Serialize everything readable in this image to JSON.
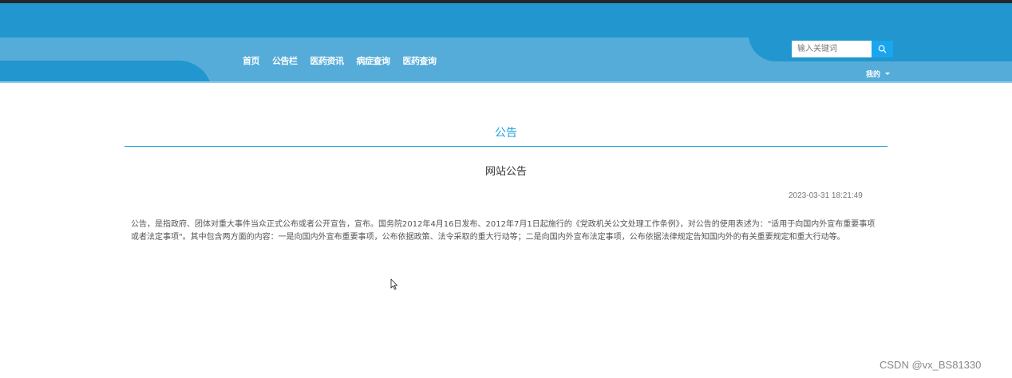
{
  "nav": {
    "items": [
      {
        "label": "首页"
      },
      {
        "label": "公告栏"
      },
      {
        "label": "医药资讯"
      },
      {
        "label": "病症查询"
      },
      {
        "label": "医药查询"
      }
    ]
  },
  "search": {
    "placeholder": "输入关键词",
    "value": ""
  },
  "user_menu": {
    "label": "我的"
  },
  "section": {
    "title": "公告"
  },
  "article": {
    "title": "网站公告",
    "date": "2023-03-31 18:21:49",
    "body": "公告，是指政府、团体对重大事件当众正式公布或者公开宣告，宣布。国务院2012年4月16日发布、2012年7月1日起施行的《党政机关公文处理工作条例》，对公告的使用表述为：\"适用于向国内外宣布重要事项或者法定事项\"。其中包含两方面的内容：一是向国内外宣布重要事项，公布依据政策、法令采取的重大行动等；二是向国内外宣布法定事项，公布依据法律规定告知国内外的有关重要规定和重大行动等。"
  },
  "watermark": "CSDN @vx_BS81330",
  "colors": {
    "header_primary": "#2196cf",
    "header_band": "#55acd8",
    "accent": "#1fa0da",
    "search_button": "#19a6ee"
  }
}
